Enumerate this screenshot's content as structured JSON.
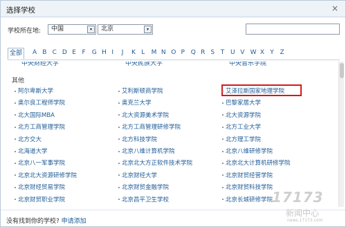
{
  "dialog": {
    "title": "选择学校",
    "close": "×"
  },
  "location": {
    "label": "学校所在地:",
    "country": "中国",
    "city": "北京",
    "arrow": "▾"
  },
  "search": {
    "value": "",
    "placeholder": ""
  },
  "letters": {
    "all": "全部",
    "items": [
      "A",
      "B",
      "C",
      "D",
      "E",
      "F",
      "G",
      "H",
      "I",
      "J",
      "K",
      "L",
      "M",
      "N",
      "O",
      "P",
      "Q",
      "R",
      "S",
      "T",
      "U",
      "V",
      "W",
      "X",
      "Y",
      "Z"
    ]
  },
  "list": {
    "cut_row": [
      "中央财经大学",
      "中央民族大学",
      "中央音乐学院"
    ],
    "group_label": "其他",
    "schools": [
      [
        "阿尔卑斯大学",
        "艾利斯顿商学院",
        "艾泽拉斯国家地理学院"
      ],
      [
        "奥尔良工程师学院",
        "奥克兰大学",
        "巴黎家居大学"
      ],
      [
        "北大国际MBA",
        "北大资源美术学院",
        "北大资源学院"
      ],
      [
        "北方工商管理学院",
        "北方工商管理研修学院",
        "北方工业大学"
      ],
      [
        "北方交大",
        "北方科技学院",
        "北方理工学院"
      ],
      [
        "北海道大学",
        "北京八维计算机学院",
        "北京八维研修学院"
      ],
      [
        "北京八一军事学院",
        "北京北大方正软件技术学院",
        "北京北大计算机研修学院"
      ],
      [
        "北京北大资源研修学院",
        "北京财经大学",
        "北京财贸经营学院"
      ],
      [
        "北京财经贸易学院",
        "北京财贸金融学院",
        "北京财贸科技学院"
      ],
      [
        "北京财贸职业学院",
        "北京昌平卫生学校",
        "北京长城研修学院"
      ]
    ]
  },
  "footer": {
    "note": "没有找到你的学校?",
    "apply": "申请添加"
  },
  "watermark": {
    "number": "17173",
    "cn": "新闻中心",
    "url": "news.17173.com"
  }
}
